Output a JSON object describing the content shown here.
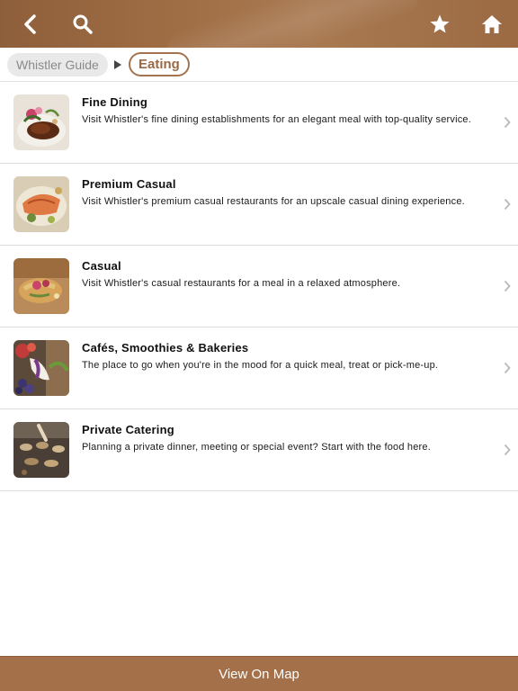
{
  "header": {
    "back_icon": "chevron-left-icon",
    "search_icon": "search-icon",
    "favorite_icon": "star-icon",
    "home_icon": "home-icon"
  },
  "breadcrumb": {
    "root": "Whistler Guide",
    "current": "Eating"
  },
  "items": [
    {
      "title": "Fine Dining",
      "description": "Visit Whistler's fine dining establishments for an elegant meal with top-quality service."
    },
    {
      "title": "Premium Casual",
      "description": "Visit Whistler's premium casual restaurants for an upscale casual dining experience."
    },
    {
      "title": "Casual",
      "description": "Visit Whistler's casual restaurants for a meal in a relaxed atmosphere."
    },
    {
      "title": "Cafés, Smoothies & Bakeries",
      "description": "The place to go when you're in the mood for a quick meal, treat or pick-me-up."
    },
    {
      "title": "Private Catering",
      "description": "Planning a private dinner, meeting or special event? Start with the food here."
    }
  ],
  "footer": {
    "label": "View On Map"
  },
  "colors": {
    "brand": "#a37049",
    "accent": "#9a6a46"
  }
}
